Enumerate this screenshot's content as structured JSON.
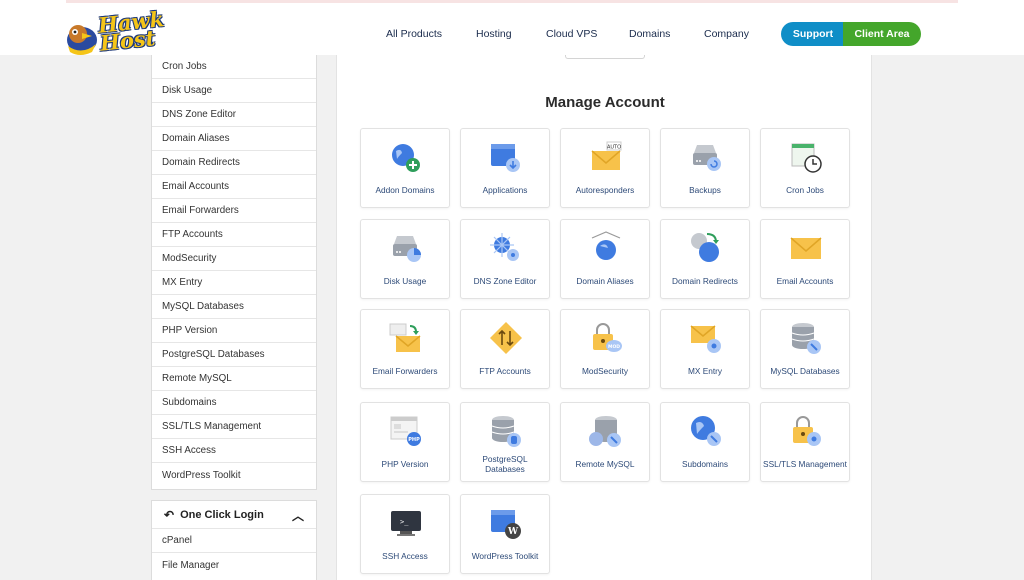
{
  "logo": {
    "text": "Hawk Host"
  },
  "nav": [
    "All Products",
    "Hosting",
    "Cloud VPS",
    "Domains",
    "Company"
  ],
  "buttons": {
    "support": "Support",
    "client_area": "Client Area"
  },
  "sidebar": {
    "items": [
      "Cron Jobs",
      "Disk Usage",
      "DNS Zone Editor",
      "Domain Aliases",
      "Domain Redirects",
      "Email Accounts",
      "Email Forwarders",
      "FTP Accounts",
      "ModSecurity",
      "MX Entry",
      "MySQL Databases",
      "PHP Version",
      "PostgreSQL Databases",
      "Remote MySQL",
      "Subdomains",
      "SSL/TLS Management",
      "SSH Access",
      "WordPress Toolkit"
    ]
  },
  "one_click": {
    "title": "One Click Login",
    "items": [
      "cPanel",
      "File Manager"
    ]
  },
  "main": {
    "title": "Manage Account",
    "tiles": [
      {
        "label": "Addon Domains",
        "icon": "addon-domains-icon"
      },
      {
        "label": "Applications",
        "icon": "applications-icon"
      },
      {
        "label": "Autoresponders",
        "icon": "autoresponders-icon",
        "badge": "AUTO"
      },
      {
        "label": "Backups",
        "icon": "backups-icon"
      },
      {
        "label": "Cron Jobs",
        "icon": "cron-jobs-icon"
      },
      {
        "label": "Disk Usage",
        "icon": "disk-usage-icon"
      },
      {
        "label": "DNS Zone Editor",
        "icon": "dns-zone-editor-icon"
      },
      {
        "label": "Domain Aliases",
        "icon": "domain-aliases-icon"
      },
      {
        "label": "Domain Redirects",
        "icon": "domain-redirects-icon"
      },
      {
        "label": "Email Accounts",
        "icon": "email-accounts-icon"
      },
      {
        "label": "Email Forwarders",
        "icon": "email-forwarders-icon"
      },
      {
        "label": "FTP Accounts",
        "icon": "ftp-accounts-icon"
      },
      {
        "label": "ModSecurity",
        "icon": "modsecurity-icon",
        "badge": "MOD"
      },
      {
        "label": "MX Entry",
        "icon": "mx-entry-icon"
      },
      {
        "label": "MySQL Databases",
        "icon": "mysql-databases-icon"
      },
      {
        "label": "PHP Version",
        "icon": "php-version-icon",
        "badge": "PHP"
      },
      {
        "label": "PostgreSQL Databases",
        "icon": "postgresql-databases-icon"
      },
      {
        "label": "Remote MySQL",
        "icon": "remote-mysql-icon"
      },
      {
        "label": "Subdomains",
        "icon": "subdomains-icon"
      },
      {
        "label": "SSL/TLS Management",
        "icon": "ssl-tls-management-icon"
      },
      {
        "label": "SSH Access",
        "icon": "ssh-access-icon",
        "badge": ">_"
      },
      {
        "label": "WordPress Toolkit",
        "icon": "wordpress-toolkit-icon",
        "badge": "W"
      }
    ]
  },
  "colors": {
    "support": "#0f8ec7",
    "client_area": "#44a62b",
    "icon_blue": "#3f7be0",
    "icon_yellow": "#f7c24a",
    "icon_grey": "#9aa1ab"
  }
}
